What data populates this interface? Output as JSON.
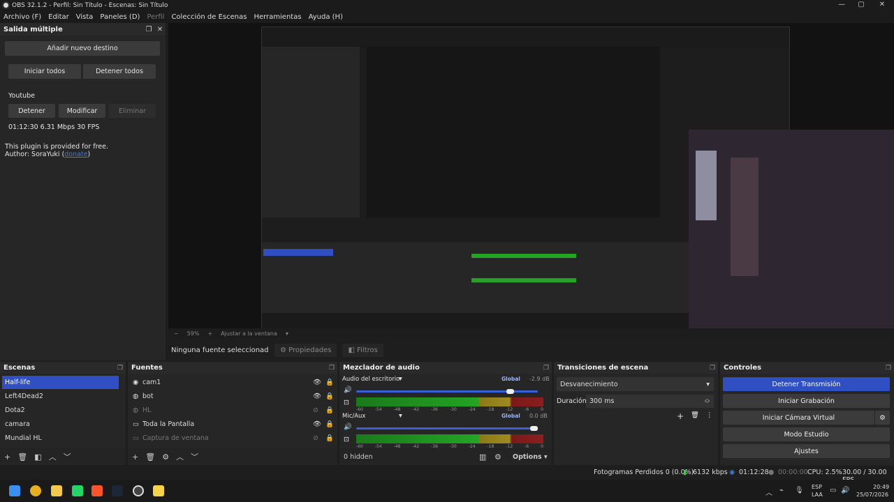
{
  "window": {
    "title": "OBS 32.1.2 - Perfil: Sin Título - Escenas: Sin Título"
  },
  "menu": [
    "Archivo (F)",
    "Editar",
    "Vista",
    "Paneles (D)",
    "Perfil",
    "Colección de Escenas",
    "Herramientas",
    "Ayuda (H)"
  ],
  "multi": {
    "title": "Salida múltiple",
    "add_btn": "Añadir nuevo destino",
    "start_all": "Iniciar todos",
    "stop_all": "Detener todos",
    "target_name": "Youtube",
    "stop": "Detener",
    "modify": "Modificar",
    "delete": "Eliminar",
    "stats": "01:12:30  6.31 Mbps  30 FPS",
    "free_text": "This plugin is provided for free.",
    "author_prefix": "Author: SoraYuki (",
    "donate": "donate",
    "author_suffix": ")"
  },
  "zoom": {
    "percent": "59%",
    "fit": "Ajustar a la ventana"
  },
  "source_bar": {
    "selected": "Ninguna fuente seleccionad",
    "props": "Propiedades",
    "filters": "Filtros"
  },
  "scenes": {
    "title": "Escenas",
    "items": [
      "Half-life",
      "Left4Dead2",
      "Dota2",
      "camara",
      "Mundial HL"
    ]
  },
  "sources": {
    "title": "Fuentes",
    "items": [
      "cam1",
      "bot",
      "HL",
      "Toda la Pantalla",
      "Captura de ventana"
    ]
  },
  "mixer": {
    "title": "Mezclador de audio",
    "ch1": {
      "name": "Audio del escritorio",
      "global": "Global",
      "db": "-2.9 dB",
      "level": 0.87
    },
    "ch2": {
      "name": "Mic/Aux",
      "global": "Global",
      "db": "0.0 dB",
      "level": 1.0
    },
    "scale": [
      "-60",
      "-54",
      "-48",
      "-42",
      "-36",
      "-30",
      "-24",
      "-18",
      "-12",
      "-6",
      "0"
    ],
    "hidden": "0 hidden",
    "options": "Options"
  },
  "transitions": {
    "title": "Transiciones de escena",
    "type": "Desvanecimiento",
    "duration_label": "Duración",
    "duration": "300 ms"
  },
  "controls": {
    "title": "Controles",
    "stop_stream": "Detener Transmisión",
    "start_rec": "Iniciar Grabación",
    "virtual_cam": "Iniciar Cámara Virtual",
    "studio": "Modo Estudio",
    "settings": "Ajustes"
  },
  "status": {
    "dropped": "Fotogramas Perdidos 0 (0.0%)",
    "kbps": "6132 kbps",
    "stream_time": "01:12:28",
    "rec_time": "00:00:00",
    "cpu": "CPU: 2.5%",
    "fps": "30.00 / 30.00 FPS"
  },
  "tray": {
    "lang": "ESP",
    "layout": "LAA",
    "time": "20:49",
    "date": "25/07/2026"
  },
  "colors": {
    "accent": "#2f4fc2",
    "bg": "#1e1e1e"
  }
}
